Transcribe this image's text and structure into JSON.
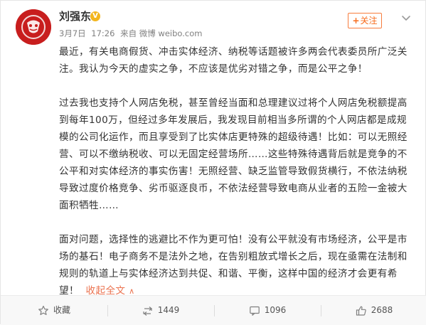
{
  "author": {
    "name": "刘强东",
    "verified_badge": "V"
  },
  "meta": {
    "date": "3月7日",
    "time": "17:26",
    "source": "来自 微博 weibo.com"
  },
  "follow_button": {
    "label": "关注"
  },
  "post": {
    "paragraphs": [
      "最近，有关电商假货、冲击实体经济、纳税等话题被许多两会代表委员所广泛关注。我认为今天的虚实之争，不应该是优劣对错之争，而是公平之争！",
      "过去我也支持个人网店免税，甚至曾经当面和总理建议过将个人网店免税额提高到每年100万，但经过多年发展后，我发现目前相当多所谓的个人网店都是成规模的公司化运作，而且享受到了比实体店更特殊的超级待遇！比如：可以无照经营、可以不缴纳税收、可以无固定经营场所……这些特殊待遇背后就是竞争的不公平和对实体经济的事实伤害！无照经营、缺乏监管导致假货横行，不依法纳税导致过度价格竞争、劣币驱逐良币，不依法经营导致电商从业者的五险一金被大面积牺牲……",
      "面对问题，选择性的逃避比不作为更可怕！没有公平就没有市场经济，公平是市场的基石！电子商务不是法外之地，在告别粗放式增长之后，现在亟需在法制和规则的轨道上与实体经济达到共促、和谐、平衡，这样中国的经济才会更有希望！"
    ],
    "collapse_label": "收起全文",
    "collapse_arrow": "∧"
  },
  "actions": [
    {
      "name": "favorite",
      "label": "收藏",
      "icon": "star-icon"
    },
    {
      "name": "repost",
      "label": "1449",
      "icon": "repost-icon"
    },
    {
      "name": "comment",
      "label": "1096",
      "icon": "comment-icon"
    },
    {
      "name": "like",
      "label": "2688",
      "icon": "thumbs-up-icon"
    }
  ],
  "colors": {
    "accent": "#eb7350",
    "follow_border": "#f77c3d",
    "badge": "#f3b61f",
    "avatar_bg": "#c81e1e"
  }
}
